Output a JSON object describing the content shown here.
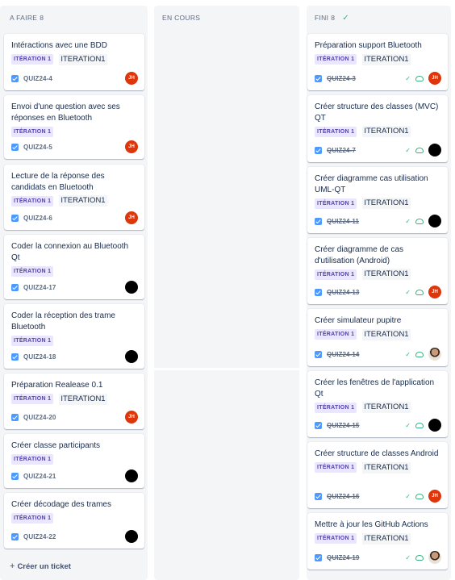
{
  "columns": {
    "todo": {
      "title": "A FAIRE",
      "count": "8",
      "create_label": "Créer un ticket",
      "cards": [
        {
          "title": "Intéractions avec une BDD",
          "epic": "ITÉRATION 1",
          "sprint": "ITERATION1",
          "key": "QUIZ24-4",
          "avatar": "JH",
          "avatar_type": "initials"
        },
        {
          "title": "Envoi d'une question avec ses réponses en Bluetooth",
          "epic": "ITÉRATION 1",
          "sprint": "",
          "key": "QUIZ24-5",
          "avatar": "JH",
          "avatar_type": "initials"
        },
        {
          "title": "Lecture de la réponse des candidats en Bluetooth",
          "epic": "ITÉRATION 1",
          "sprint": "ITERATION1",
          "key": "QUIZ24-6",
          "avatar": "JH",
          "avatar_type": "initials"
        },
        {
          "title": "Coder la connexion au Bluetooth Qt",
          "epic": "ITÉRATION 1",
          "sprint": "",
          "key": "QUIZ24-17",
          "avatar": "",
          "avatar_type": "black"
        },
        {
          "title": "Coder la réception des trame Bluetooth",
          "epic": "ITÉRATION 1",
          "sprint": "",
          "key": "QUIZ24-18",
          "avatar": "",
          "avatar_type": "black"
        },
        {
          "title": "Préparation Realease 0.1",
          "epic": "ITÉRATION 1",
          "sprint": "ITERATION1",
          "key": "QUIZ24-20",
          "avatar": "JH",
          "avatar_type": "initials"
        },
        {
          "title": "Créer classe participants",
          "epic": "ITÉRATION 1",
          "sprint": "",
          "key": "QUIZ24-21",
          "avatar": "",
          "avatar_type": "black"
        },
        {
          "title": "Créer décodage des trames",
          "epic": "ITÉRATION 1",
          "sprint": "",
          "key": "QUIZ24-22",
          "avatar": "",
          "avatar_type": "black"
        }
      ]
    },
    "progress": {
      "title": "EN COURS"
    },
    "done": {
      "title": "FINI",
      "count": "8",
      "cards": [
        {
          "title": "Préparation support Bluetooth",
          "epic": "ITÉRATION 1",
          "sprint": "ITERATION1",
          "key": "QUIZ24-3",
          "avatar": "JH",
          "avatar_type": "initials"
        },
        {
          "title": "Créer structure des classes (MVC) QT",
          "epic": "ITÉRATION 1",
          "sprint": "ITERATION1",
          "key": "QUIZ24-7",
          "avatar": "",
          "avatar_type": "black"
        },
        {
          "title": "Créer diagramme cas utilisation UML-QT",
          "epic": "ITÉRATION 1",
          "sprint": "ITERATION1",
          "key": "QUIZ24-11",
          "avatar": "",
          "avatar_type": "black"
        },
        {
          "title": "Créer diagramme de cas d'utilisation (Android)",
          "epic": "ITÉRATION 1",
          "sprint": "ITERATION1",
          "key": "QUIZ24-13",
          "avatar": "JH",
          "avatar_type": "initials"
        },
        {
          "title": "Créer simulateur pupitre",
          "epic": "ITÉRATION 1",
          "sprint": "ITERATION1",
          "key": "QUIZ24-14",
          "avatar": "",
          "avatar_type": "photo"
        },
        {
          "title": "Créer les fenêtres de l'application Qt",
          "epic": "ITÉRATION 1",
          "sprint": "ITERATION1",
          "key": "QUIZ24-15",
          "avatar": "",
          "avatar_type": "black"
        },
        {
          "title": "Créer structure de classes Android",
          "epic": "ITÉRATION 1",
          "sprint": "ITERATION1",
          "key": "QUIZ24-16",
          "avatar": "JH",
          "avatar_type": "initials"
        },
        {
          "title": "Mettre à jour les GitHub Actions",
          "epic": "ITÉRATION 1",
          "sprint": "ITERATION1",
          "key": "QUIZ24-19",
          "avatar": "",
          "avatar_type": "photo"
        }
      ]
    }
  },
  "colors": {
    "column_bg": "#f4f5f7",
    "epic_bg": "#eae6ff",
    "epic_text": "#5243aa",
    "checkbox": "#4c9aff",
    "done_green": "#36b37e",
    "avatar_jh": "#de350b"
  },
  "icons": {
    "done_header": "check-icon",
    "status": [
      "tick-icon",
      "cloud-sync-icon"
    ],
    "create": "plus-icon"
  }
}
